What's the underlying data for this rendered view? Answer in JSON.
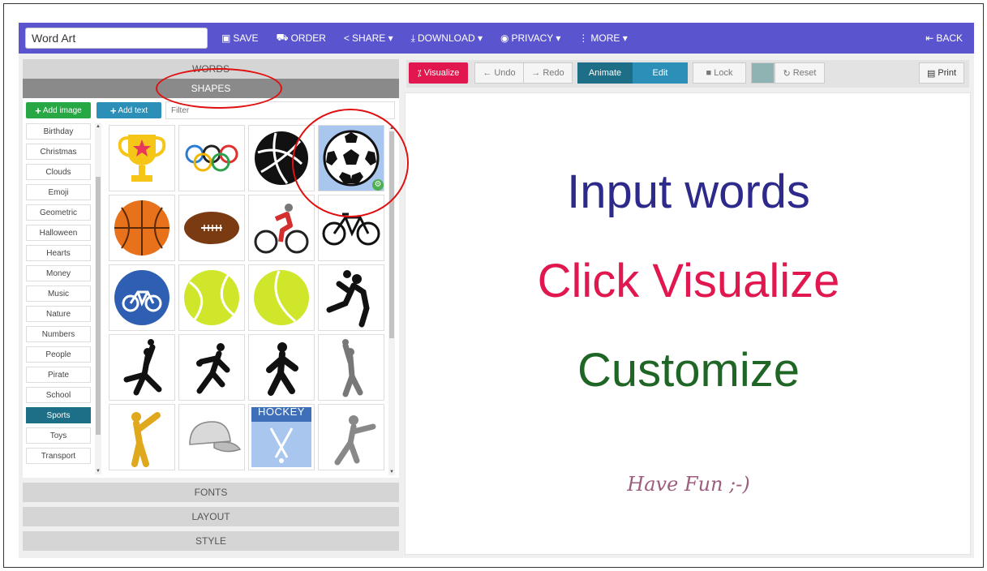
{
  "header": {
    "title_value": "Word Art",
    "menu": [
      {
        "label": "SAVE",
        "icon": "save-icon",
        "glyph": "💾"
      },
      {
        "label": "ORDER",
        "icon": "cart-icon",
        "glyph": "🛒"
      },
      {
        "label": "SHARE ▾",
        "icon": "share-icon",
        "glyph": "<"
      },
      {
        "label": "DOWNLOAD ▾",
        "icon": "download-icon",
        "glyph": "⬇"
      },
      {
        "label": "PRIVACY ▾",
        "icon": "eye-icon",
        "glyph": "👁"
      },
      {
        "label": "MORE ▾",
        "icon": "more-icon",
        "glyph": "⋮"
      }
    ],
    "back_label": "BACK"
  },
  "left_panel": {
    "words_label": "WORDS",
    "shapes_label": "SHAPES",
    "fonts_label": "FONTS",
    "layout_label": "LAYOUT",
    "style_label": "STYLE",
    "add_image_label": "Add image",
    "add_text_label": "Add text",
    "filter_placeholder": "Filter",
    "categories": [
      "Birthday",
      "Christmas",
      "Clouds",
      "Emoji",
      "Geometric",
      "Halloween",
      "Hearts",
      "Money",
      "Music",
      "Nature",
      "Numbers",
      "People",
      "Pirate",
      "School",
      "Sports",
      "Toys",
      "Transport"
    ],
    "active_category": "Sports",
    "hockey_text": "HOCKEY"
  },
  "toolbar": {
    "visualize_label": "Visualize",
    "undo_label": "Undo",
    "redo_label": "Redo",
    "animate_label": "Animate",
    "edit_label": "Edit",
    "lock_label": "Lock",
    "reset_label": "Reset",
    "print_label": "Print",
    "color_swatch": "#8fb3b3"
  },
  "canvas": {
    "line1": "Input words",
    "line2": "Click Visualize",
    "line3": "Customize",
    "line4": "Have Fun ;-)"
  },
  "colors": {
    "topbar": "#5a55cf",
    "visualize": "#e0184f",
    "animate": "#1c6f86",
    "edit": "#2b8fb8",
    "line1": "#2e2a8c",
    "line2": "#e0184f",
    "line3": "#1f6626",
    "line4": "#9c5e7e"
  }
}
